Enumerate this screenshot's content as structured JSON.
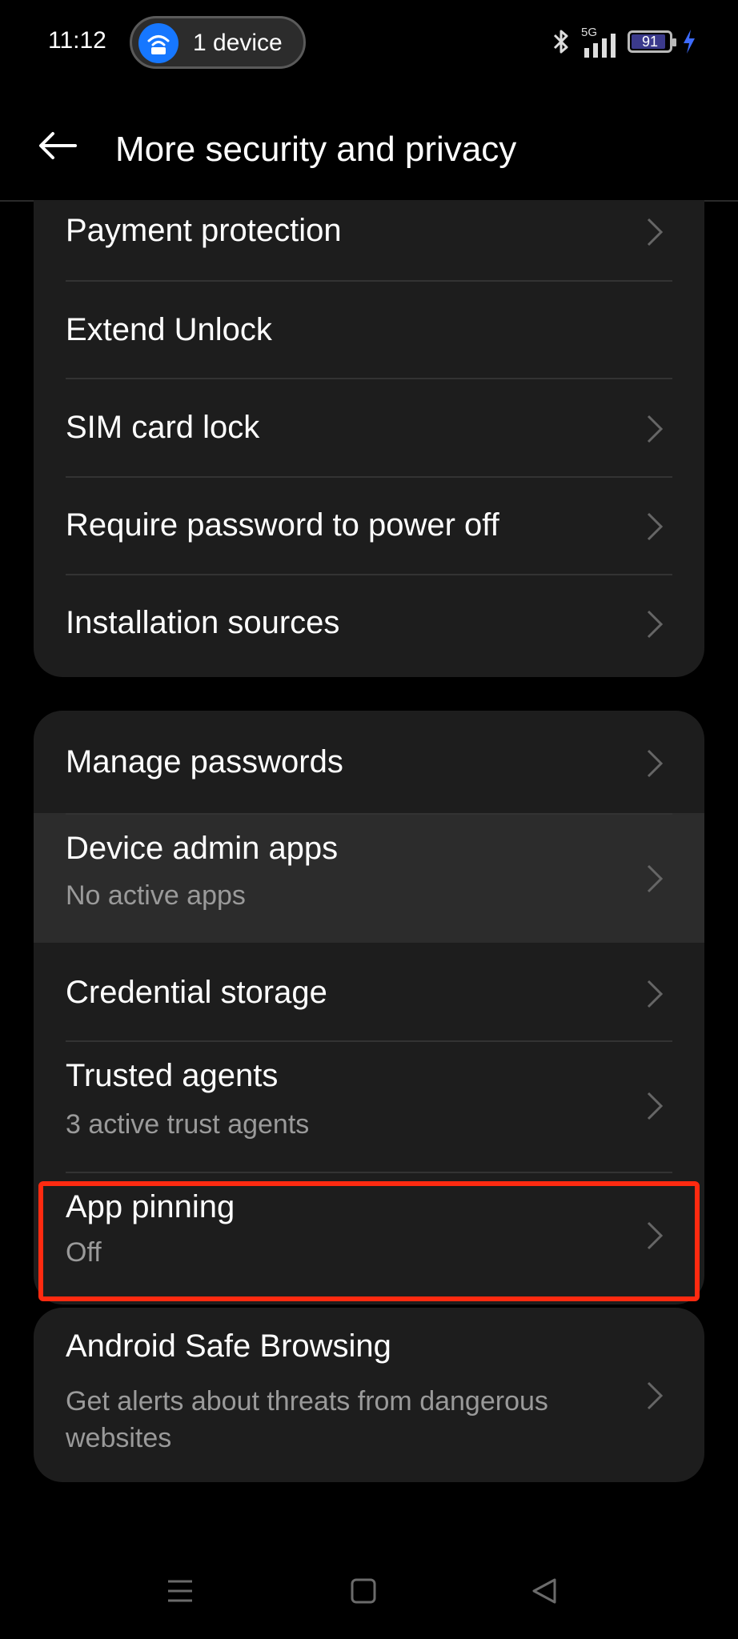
{
  "status_bar": {
    "time": "11:12",
    "hotspot_label": "1 device",
    "network": "5G",
    "battery": "91",
    "battery_level": 0.91,
    "icons": [
      "bluetooth-icon",
      "signal-icon",
      "battery-icon",
      "charging-icon"
    ]
  },
  "header": {
    "title": "More security and privacy",
    "back_icon": "arrow-left-icon"
  },
  "group1": {
    "items": [
      {
        "title": "Payment protection",
        "chevron": true
      },
      {
        "title": "Extend Unlock",
        "chevron": false
      },
      {
        "title": "SIM card lock",
        "chevron": true
      },
      {
        "title": "Require password to power off",
        "chevron": true
      },
      {
        "title": "Installation sources",
        "chevron": true
      }
    ]
  },
  "group2": {
    "items": [
      {
        "title": "Manage passwords"
      },
      {
        "title": "Device admin apps",
        "subtitle": "No active apps"
      },
      {
        "title": "Credential storage"
      },
      {
        "title": "Trusted agents",
        "subtitle": "3 active trust agents"
      },
      {
        "title": "App pinning",
        "subtitle": "Off"
      }
    ]
  },
  "group3": {
    "items": [
      {
        "title": "Android Safe Browsing",
        "subtitle_line1": "Get alerts about threats from dangerous",
        "subtitle_line2": "websites"
      }
    ]
  },
  "colors": {
    "background": "#000000",
    "card": "#1d1d1d",
    "highlight_row": "#2c2c2c",
    "annotation": "#ff2a10",
    "hotspot_accent": "#1677ff"
  },
  "nav_icons": [
    "menu-icon",
    "home-square-icon",
    "back-triangle-icon"
  ]
}
